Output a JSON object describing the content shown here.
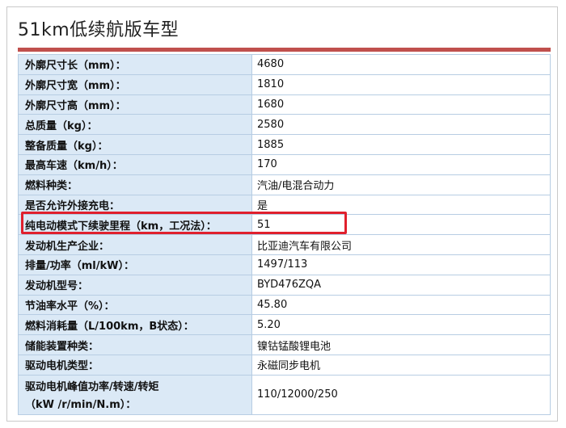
{
  "title": "51km低续航版车型",
  "colors": {
    "accent_rule": "#c0504d",
    "label_bg": "#dbe9f6",
    "highlight": "#e0202d"
  },
  "rows": [
    {
      "label": "外廓尺寸长（mm）：",
      "value": "4680"
    },
    {
      "label": "外廓尺寸宽（mm）：",
      "value": "1810"
    },
    {
      "label": "外廓尺寸高（mm）：",
      "value": "1680"
    },
    {
      "label": "总质量（kg）：",
      "value": "2580"
    },
    {
      "label": "整备质量（kg）：",
      "value": "1885"
    },
    {
      "label": "最高车速（km/h）：",
      "value": "170"
    },
    {
      "label": "燃料种类：",
      "value": "汽油/电混合动力"
    },
    {
      "label": "是否允许外接充电：",
      "value": "是"
    },
    {
      "label": "纯电动模式下续驶里程（km，工况法）：",
      "value": "51"
    },
    {
      "label": "发动机生产企业：",
      "value": "比亚迪汽车有限公司"
    },
    {
      "label": "排量/功率（ml/kW）：",
      "value": "1497/113"
    },
    {
      "label": "发动机型号：",
      "value": "BYD476ZQA"
    },
    {
      "label": "节油率水平（%）：",
      "value": "45.80"
    },
    {
      "label": "燃料消耗量（L/100km，B状态）：",
      "value": "5.20"
    },
    {
      "label": "储能装置种类：",
      "value": "镍钴锰酸锂电池"
    },
    {
      "label": "驱动电机类型：",
      "value": "永磁同步电机"
    },
    {
      "label": "驱动电机峰值功率/转速/转矩",
      "label_line2": "（kW /r/min/N.m）：",
      "value": "110/12000/250"
    }
  ]
}
